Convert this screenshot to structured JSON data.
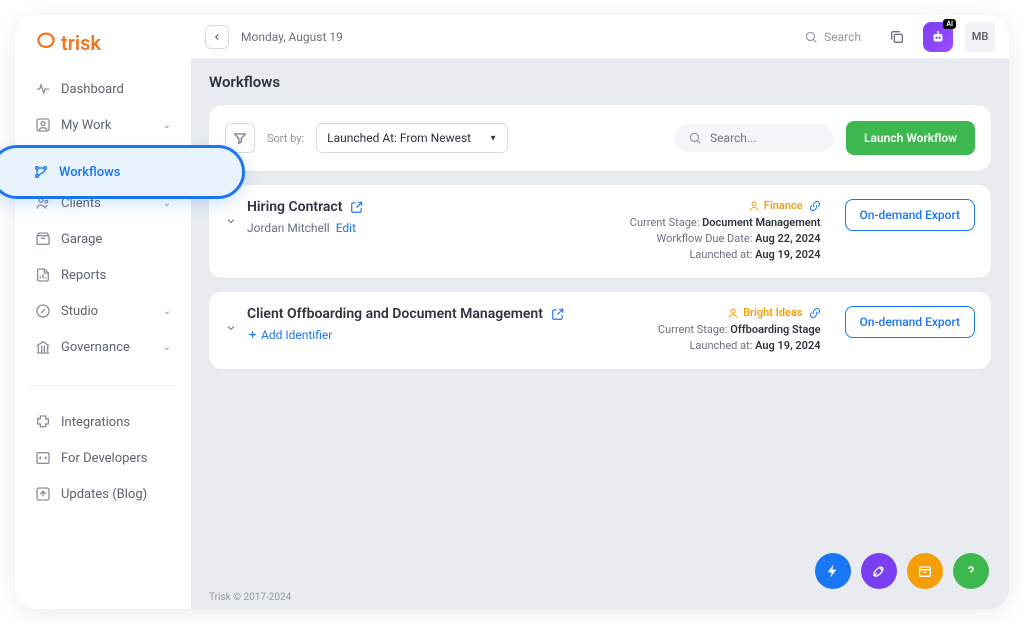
{
  "brand": {
    "name": "trisk"
  },
  "header": {
    "date": "Monday, August 19",
    "search_label": "Search",
    "user_initials": "MB"
  },
  "sidebar": {
    "items": [
      {
        "label": "Dashboard",
        "icon": "pulse-icon",
        "expandable": false
      },
      {
        "label": "My Work",
        "icon": "user-icon",
        "expandable": true
      },
      {
        "label": "Workflows",
        "icon": "branch-icon",
        "active": true
      },
      {
        "label": "Clients",
        "icon": "users-icon",
        "expandable": true
      },
      {
        "label": "Garage",
        "icon": "box-icon",
        "expandable": false
      },
      {
        "label": "Reports",
        "icon": "report-icon",
        "expandable": false
      },
      {
        "label": "Studio",
        "icon": "edit-icon",
        "expandable": true
      },
      {
        "label": "Governance",
        "icon": "governance-icon",
        "expandable": true
      }
    ],
    "secondary": [
      {
        "label": "Integrations",
        "icon": "puzzle-icon"
      },
      {
        "label": "For Developers",
        "icon": "code-icon"
      },
      {
        "label": "Updates (Blog)",
        "icon": "arrow-up-icon"
      }
    ]
  },
  "page": {
    "title": "Workflows"
  },
  "filters": {
    "sort_label": "Sort by:",
    "sort_value": "Launched At: From Newest",
    "search_placeholder": "Search...",
    "launch_button": "Launch Workflow"
  },
  "workflows": [
    {
      "title": "Hiring Contract",
      "identifier": "Jordan Mitchell",
      "identifier_action": "Edit",
      "tag": "Finance",
      "stage_label": "Current Stage:",
      "stage_value": "Document Management",
      "due_label": "Workflow Due Date:",
      "due_value": "Aug 22, 2024",
      "launched_label": "Launched at:",
      "launched_value": "Aug 19, 2024",
      "export_label": "On-demand Export"
    },
    {
      "title": "Client Offboarding and Document Management",
      "add_identifier_label": "Add Identifier",
      "tag": "Bright Ideas",
      "stage_label": "Current Stage:",
      "stage_value": "Offboarding Stage",
      "launched_label": "Launched at:",
      "launched_value": "Aug 19, 2024",
      "export_label": "On-demand Export"
    }
  ],
  "footer": {
    "copyright": "Trisk © 2017-2024"
  }
}
